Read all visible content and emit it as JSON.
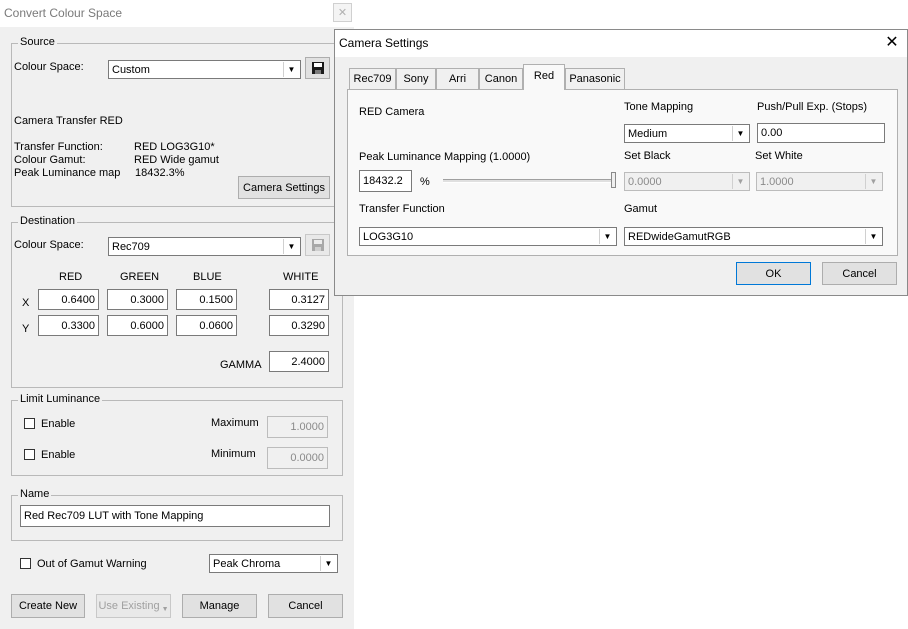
{
  "main": {
    "title": "Convert Colour Space",
    "source": {
      "legend": "Source",
      "colour_space_label": "Colour Space:",
      "colour_space_value": "Custom",
      "camera_transfer_heading": "Camera Transfer RED",
      "transfer_function_label": "Transfer Function:",
      "transfer_function_value": "RED LOG3G10*",
      "colour_gamut_label": "Colour Gamut:",
      "colour_gamut_value": "RED Wide gamut",
      "peak_luminance_label": "Peak Luminance map",
      "peak_luminance_value": "18432.3%",
      "camera_settings_button": "Camera Settings"
    },
    "destination": {
      "legend": "Destination",
      "colour_space_label": "Colour Space:",
      "colour_space_value": "Rec709",
      "col_red": "RED",
      "col_green": "GREEN",
      "col_blue": "BLUE",
      "col_white": "WHITE",
      "row_x": "X",
      "row_y": "Y",
      "x_values": [
        "0.6400",
        "0.3000",
        "0.1500",
        "0.3127"
      ],
      "y_values": [
        "0.3300",
        "0.6000",
        "0.0600",
        "0.3290"
      ],
      "gamma_label": "GAMMA",
      "gamma_value": "2.4000"
    },
    "limit_luminance": {
      "legend": "Limit Luminance",
      "enable1_label": "Enable",
      "maximum_label": "Maximum",
      "maximum_value": "1.0000",
      "enable2_label": "Enable",
      "minimum_label": "Minimum",
      "minimum_value": "0.0000"
    },
    "name": {
      "legend": "Name",
      "value": "Red Rec709 LUT with Tone Mapping"
    },
    "out_of_gamut_label": "Out of Gamut Warning",
    "gamut_mode_value": "Peak Chroma",
    "buttons": {
      "create_new": "Create New",
      "use_existing": "Use Existing",
      "manage": "Manage",
      "cancel": "Cancel"
    }
  },
  "camera": {
    "title": "Camera Settings",
    "tabs": [
      "Rec709",
      "Sony",
      "Arri",
      "Canon",
      "Red",
      "Panasonic"
    ],
    "active_tab": "Red",
    "panel": {
      "camera_name": "RED Camera",
      "tone_mapping_label": "Tone Mapping",
      "tone_mapping_value": "Medium",
      "push_pull_label": "Push/Pull Exp. (Stops)",
      "push_pull_value": "0.00",
      "peak_luminance_label": "Peak Luminance Mapping (1.0000)",
      "peak_luminance_value": "18432.2",
      "percent": "%",
      "set_black_label": "Set Black",
      "set_black_value": "0.0000",
      "set_white_label": "Set White",
      "set_white_value": "1.0000",
      "transfer_function_label": "Transfer Function",
      "transfer_function_value": "LOG3G10",
      "gamut_label": "Gamut",
      "gamut_value": "REDwideGamutRGB"
    },
    "ok_button": "OK",
    "cancel_button": "Cancel"
  },
  "colors": {
    "dialog_bg": "#f0f0f0",
    "button_bg": "#e1e1e1",
    "border": "#adadad"
  }
}
